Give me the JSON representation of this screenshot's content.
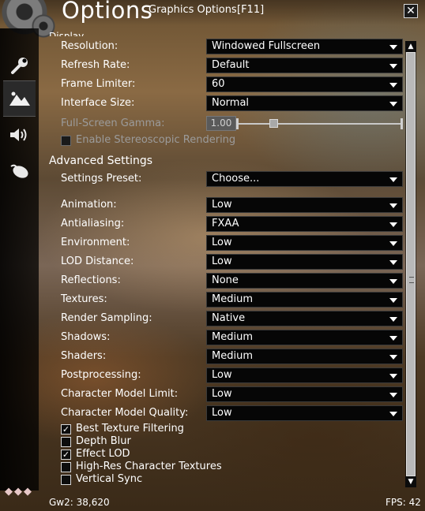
{
  "window": {
    "title": "Options",
    "subtitle": "Graphics Options",
    "shortcut": "[F11]",
    "close_symbol": "✕"
  },
  "sidebar": {
    "tabs": [
      {
        "name": "tab-general",
        "icon": "wrench-icon",
        "active": false
      },
      {
        "name": "tab-graphics",
        "icon": "mountains-icon",
        "active": true
      },
      {
        "name": "tab-sound",
        "icon": "speaker-icon",
        "active": false
      },
      {
        "name": "tab-controls",
        "icon": "mouse-icon",
        "active": false
      }
    ],
    "decoration": "◆◆◆"
  },
  "display": {
    "section_title": "Display",
    "rows": [
      {
        "label": "Resolution:",
        "value": "Windowed Fullscreen"
      },
      {
        "label": "Refresh Rate:",
        "value": "Default"
      },
      {
        "label": "Frame Limiter:",
        "value": "60"
      },
      {
        "label": "Interface Size:",
        "value": "Normal"
      }
    ],
    "gamma": {
      "label": "Full-Screen Gamma:",
      "value": "1.00",
      "slider_fraction": 0.2
    },
    "stereo": {
      "label": "Enable Stereoscopic Rendering",
      "checked": false,
      "disabled": true
    }
  },
  "advanced": {
    "section_title": "Advanced Settings",
    "preset": {
      "label": "Settings Preset:",
      "value": "Choose..."
    },
    "rows": [
      {
        "label": "Animation:",
        "value": "Low"
      },
      {
        "label": "Antialiasing:",
        "value": "FXAA"
      },
      {
        "label": "Environment:",
        "value": "Low"
      },
      {
        "label": "LOD Distance:",
        "value": "Low"
      },
      {
        "label": "Reflections:",
        "value": "None"
      },
      {
        "label": "Textures:",
        "value": "Medium"
      },
      {
        "label": "Render Sampling:",
        "value": "Native"
      },
      {
        "label": "Shadows:",
        "value": "Medium"
      },
      {
        "label": "Shaders:",
        "value": "Medium"
      },
      {
        "label": "Postprocessing:",
        "value": "Low"
      },
      {
        "label": "Character Model Limit:",
        "value": "Low"
      },
      {
        "label": "Character Model Quality:",
        "value": "Low"
      }
    ],
    "checkboxes": [
      {
        "label": "Best Texture Filtering",
        "checked": true
      },
      {
        "label": "Depth Blur",
        "checked": false
      },
      {
        "label": "Effect LOD",
        "checked": true
      },
      {
        "label": "High-Res Character Textures",
        "checked": false
      },
      {
        "label": "Vertical Sync",
        "checked": false
      }
    ]
  },
  "footer": {
    "left": "Gw2: 38,620",
    "right": "FPS: 42"
  },
  "icons": {
    "check": "✓",
    "scroll_up": "▲",
    "scroll_down": "▼"
  }
}
